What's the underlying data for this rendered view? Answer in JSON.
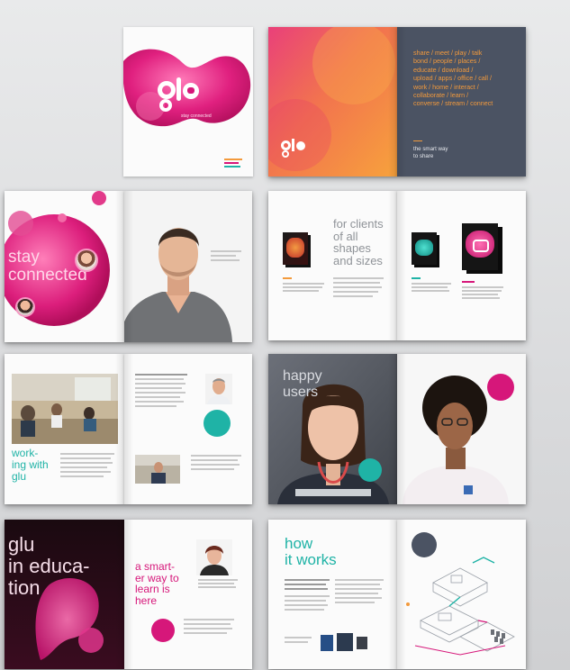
{
  "cover": {
    "tagline": "stay connected"
  },
  "spread1": {
    "words": "share / meet / play / talk\nbond / people / places /\neducate / download /\nupload / apps / office / call /\nwork / home / interact /\ncollaborate / learn /\nconverse / stream / connect",
    "tagline": "the smart way\nto share"
  },
  "spread2": {
    "headline": "stay\nconnected"
  },
  "spread3": {
    "headline": "for clients\nof all\nshapes\nand sizes"
  },
  "spread4": {
    "headline": "work-\ning with\nglu"
  },
  "spread5": {
    "headline": "happy\nusers"
  },
  "spread6": {
    "headline": "glu\nin educa-\ntion",
    "right_headline": "a smart-\ner way to\nlearn is\nhere"
  },
  "spread7": {
    "headline": "how\nit works"
  },
  "colors": {
    "accent_pink": "#d6177a",
    "accent_orange": "#f39a3c",
    "accent_teal": "#1fb3a6",
    "slate": "#4b5363"
  }
}
